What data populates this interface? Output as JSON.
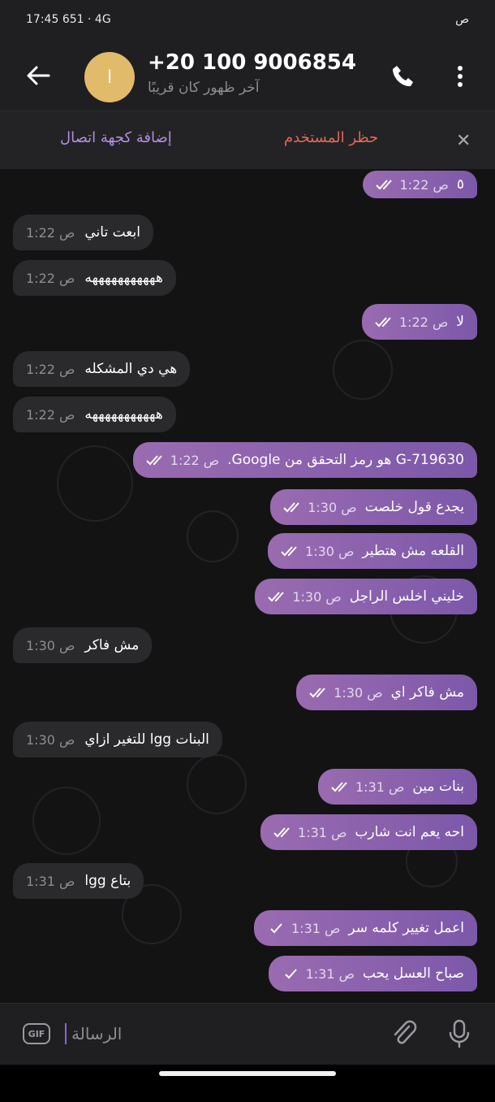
{
  "status": {
    "time": "17:45",
    "left_extra": "651",
    "network": "4G",
    "right_extra": "ص"
  },
  "header": {
    "avatar_letter": "ا",
    "title": "+20 100 9006854",
    "subtitle": "آخر ظهور كان قريبًا"
  },
  "action_bar": {
    "block_label": "حظر المستخدم",
    "add_contact_label": "إضافة كجهة اتصال"
  },
  "messages": [
    {
      "dir": "out",
      "text": "٥",
      "time": "1:22 ص",
      "check": "double"
    },
    {
      "dir": "in",
      "text": "ابعت تاني",
      "time": "1:22 ص"
    },
    {
      "dir": "in",
      "text": "هههههههههههه",
      "time": "1:22 ص"
    },
    {
      "dir": "out",
      "text": "لا",
      "time": "1:22 ص",
      "check": "double"
    },
    {
      "dir": "in",
      "text": "هي دي المشكله",
      "time": "1:22 ص"
    },
    {
      "dir": "in",
      "text": "هههههههههههه",
      "time": "1:22 ص"
    },
    {
      "dir": "out",
      "text": "G-719630 هو رمز التحقق من Google.",
      "time": "1:22 ص",
      "check": "double"
    },
    {
      "dir": "out",
      "text": "يجدع قول خلصت",
      "time": "1:30 ص",
      "check": "double"
    },
    {
      "dir": "out",
      "text": "القلعه مش هتطير",
      "time": "1:30 ص",
      "check": "double"
    },
    {
      "dir": "out",
      "text": "خليني اخلس الراجل",
      "time": "1:30 ص",
      "check": "double"
    },
    {
      "dir": "in",
      "text": "مش فاكر",
      "time": "1:30 ص"
    },
    {
      "dir": "out",
      "text": "مش فاكر اي",
      "time": "1:30 ص",
      "check": "double"
    },
    {
      "dir": "in",
      "text": "البنات lgg للتغير ازاي",
      "time": "1:30 ص"
    },
    {
      "dir": "out",
      "text": "بنات مين",
      "time": "1:31 ص",
      "check": "double"
    },
    {
      "dir": "out",
      "text": "احه يعم انت شارب",
      "time": "1:31 ص",
      "check": "double"
    },
    {
      "dir": "in",
      "text": "بتاع lgg",
      "time": "1:31 ص"
    },
    {
      "dir": "out",
      "text": "اعمل تغيير كلمه سر",
      "time": "1:31 ص",
      "check": "single"
    },
    {
      "dir": "out",
      "text": "صباح العسل يحب",
      "time": "1:31 ص",
      "check": "single"
    }
  ],
  "input": {
    "gif_label": "GIF",
    "placeholder": "الرسالة"
  },
  "colors": {
    "accent": "#8f62d2",
    "outgoing_bubble": "#8a60ad",
    "incoming_bubble": "#2a2a2c",
    "block_red": "#e06b59",
    "avatar": "#e2bb6a"
  }
}
